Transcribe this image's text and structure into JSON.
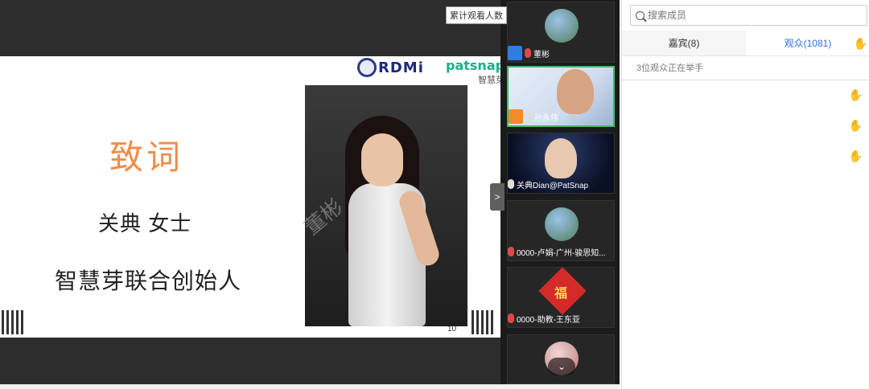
{
  "stage": {
    "view_count_label": "累计观看人数",
    "slide": {
      "logo_rdmi": "RDMi",
      "logo_patsnap_en": "patsnap",
      "logo_patsnap_cn": "智慧芽",
      "title": "致词",
      "speaker_name": "关典 女士",
      "speaker_role": "智慧芽联合创始人",
      "watermark": "董彬",
      "page_number": "10"
    },
    "collapse_arrow": ">"
  },
  "videos": {
    "tiles": [
      {
        "name": "董彬"
      },
      {
        "name": "孙永伟"
      },
      {
        "name": "关典Dian@PatSnap"
      },
      {
        "name": "0000-卢娟-广州-骏思知..."
      },
      {
        "name": "0000-助教-王东亚",
        "fu_char": "福"
      },
      {
        "name": ""
      }
    ],
    "scroll_down_glyph": "⌄"
  },
  "panel": {
    "search_placeholder": "搜索成员",
    "tabs": [
      {
        "label": "嘉宾(8)",
        "active": false
      },
      {
        "label": "观众(1081)",
        "active": true
      }
    ],
    "hand_raise_status": "3位观众正在举手",
    "hand_glyph": "✋",
    "accent_color": "#2f6fe0"
  }
}
